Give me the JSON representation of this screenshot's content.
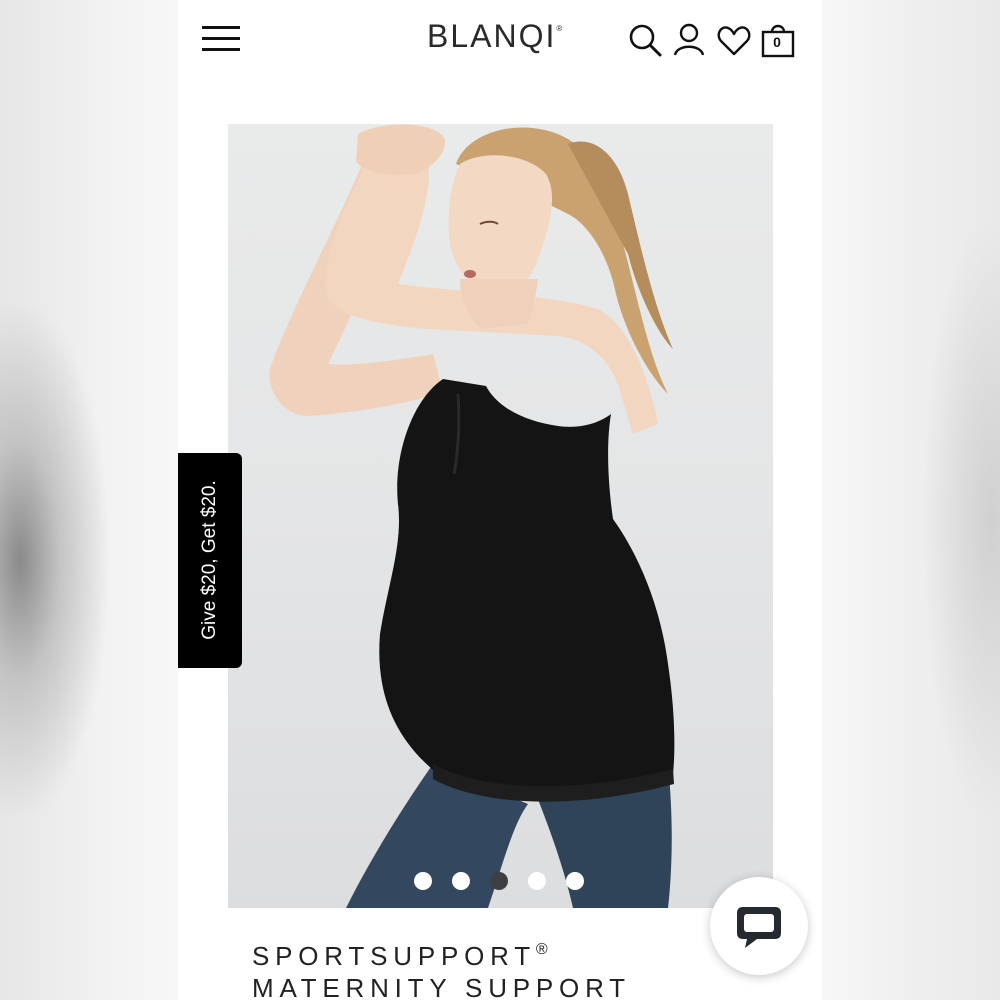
{
  "header": {
    "brand": "BLANQI",
    "brand_mark": "®",
    "cart_count": "0",
    "icons": [
      "menu-icon",
      "search-icon",
      "account-icon",
      "wishlist-heart-icon",
      "shopping-bag-icon"
    ]
  },
  "product": {
    "title_line1": "SPORTSUPPORT",
    "title_mark": "®",
    "title_line2": "MATERNITY SUPPORT"
  },
  "carousel": {
    "slide_count": 5,
    "active_index": 2
  },
  "referral_tab": {
    "label": "Give $20, Get $20."
  },
  "chat": {
    "icon": "chat-bubble-icon"
  },
  "colors": {
    "text": "#222222",
    "tab_bg": "#000000",
    "dot_active": "#3d3f42",
    "dot_inactive": "#ffffff"
  }
}
